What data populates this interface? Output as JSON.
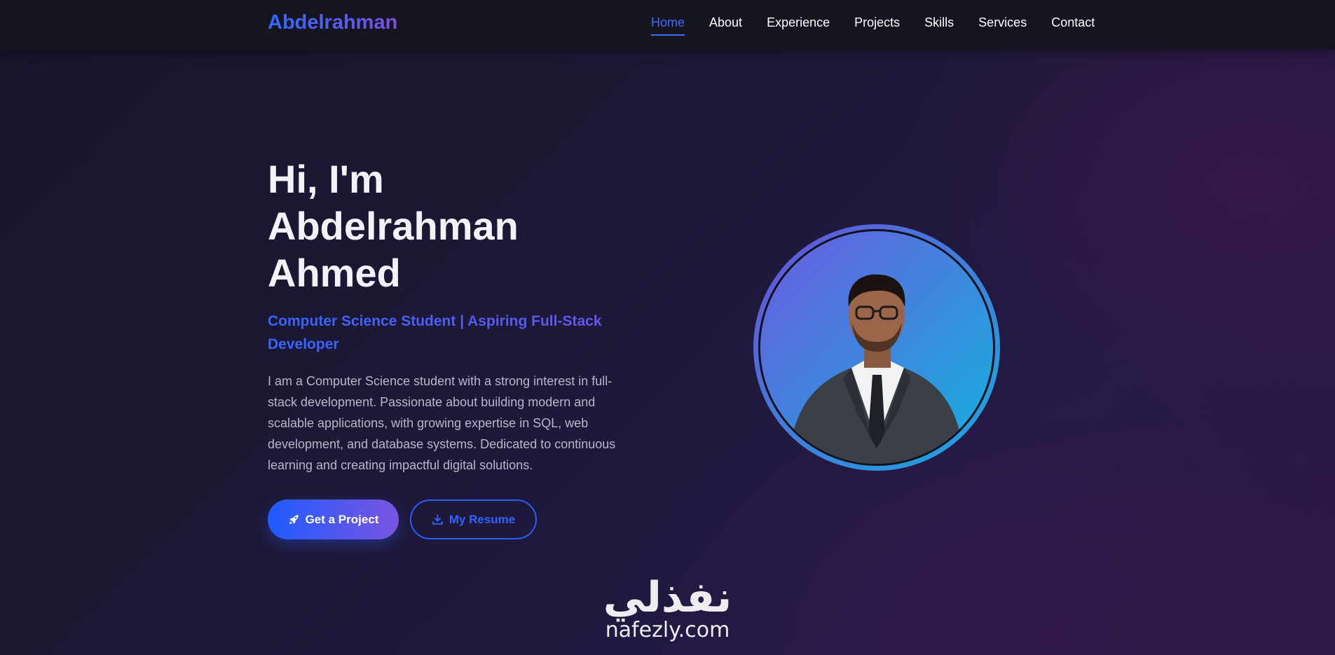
{
  "navbar": {
    "brand": "Abdelrahman",
    "links": [
      {
        "label": "Home",
        "active": true
      },
      {
        "label": "About"
      },
      {
        "label": "Experience"
      },
      {
        "label": "Projects"
      },
      {
        "label": "Skills"
      },
      {
        "label": "Services"
      },
      {
        "label": "Contact"
      }
    ]
  },
  "hero": {
    "title_lines": [
      "Hi, I'm",
      "Abdelrahman",
      "Ahmed"
    ],
    "subtitle": "Computer Science Student | Aspiring Full-Stack Developer",
    "description": "I am a Computer Science student with a strong interest in full-stack development. Passionate about building modern and scalable applications, with growing expertise in SQL, web development, and database systems. Dedicated to continuous learning and creating impactful digital solutions.",
    "primary_button": {
      "label": "Get a Project",
      "icon": "rocket-icon"
    },
    "secondary_button": {
      "label": "My Resume",
      "icon": "download-icon"
    }
  },
  "watermark": {
    "arabic": "نفذلي",
    "latin": "nafezly.com"
  },
  "colors": {
    "accent": "#3b6cff",
    "accent_purple": "#7a55e0",
    "background": "#1c1836",
    "navbar": "#151520"
  }
}
